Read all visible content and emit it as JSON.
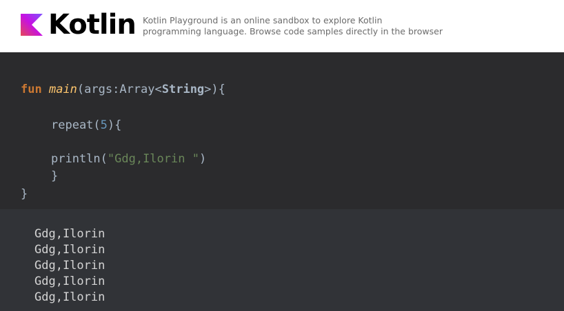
{
  "header": {
    "brand": "Kotlin",
    "tagline_line1": "Kotlin Playground is an online sandbox to explore Kotlin",
    "tagline_line2": "programming language. Browse code samples directly in the browser",
    "logo_icon": "kotlin-logo-icon",
    "logo_colors": [
      "#7f52ff",
      "#c711e1",
      "#e44857"
    ]
  },
  "editor": {
    "line1": {
      "kw": "fun",
      "name": "main",
      "args_open": "(args:Array<",
      "type": "String",
      "args_close": ">){"
    },
    "line2": {
      "call": "repeat(",
      "num": "5",
      "close": "){"
    },
    "line3": {
      "call": "println(",
      "str": "\"Gdg,Ilorin \"",
      "close": ")"
    },
    "line4": "}",
    "line5": "}"
  },
  "output": {
    "lines": [
      "Gdg,Ilorin",
      "Gdg,Ilorin",
      "Gdg,Ilorin",
      "Gdg,Ilorin",
      "Gdg,Ilorin"
    ]
  }
}
